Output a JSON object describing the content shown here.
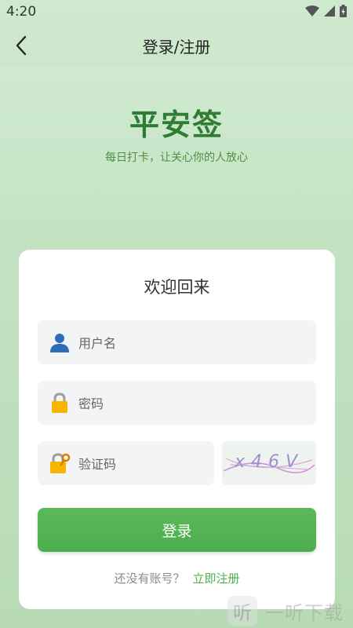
{
  "status_bar": {
    "time": "4:20"
  },
  "nav": {
    "title": "登录/注册"
  },
  "hero": {
    "app_name": "平安签",
    "slogan": "每日打卡，让关心你的人放心"
  },
  "card": {
    "welcome": "欢迎回来",
    "username_placeholder": "用户名",
    "password_placeholder": "密码",
    "captcha_placeholder": "验证码",
    "captcha_text": "x46V",
    "login_label": "登录",
    "no_account": "还没有账号？",
    "register_link": "立即注册"
  },
  "watermark": {
    "logo_glyph": "听",
    "text": "一听下载"
  },
  "colors": {
    "primary": "#4caf50",
    "brand_title": "#2e7d32"
  }
}
